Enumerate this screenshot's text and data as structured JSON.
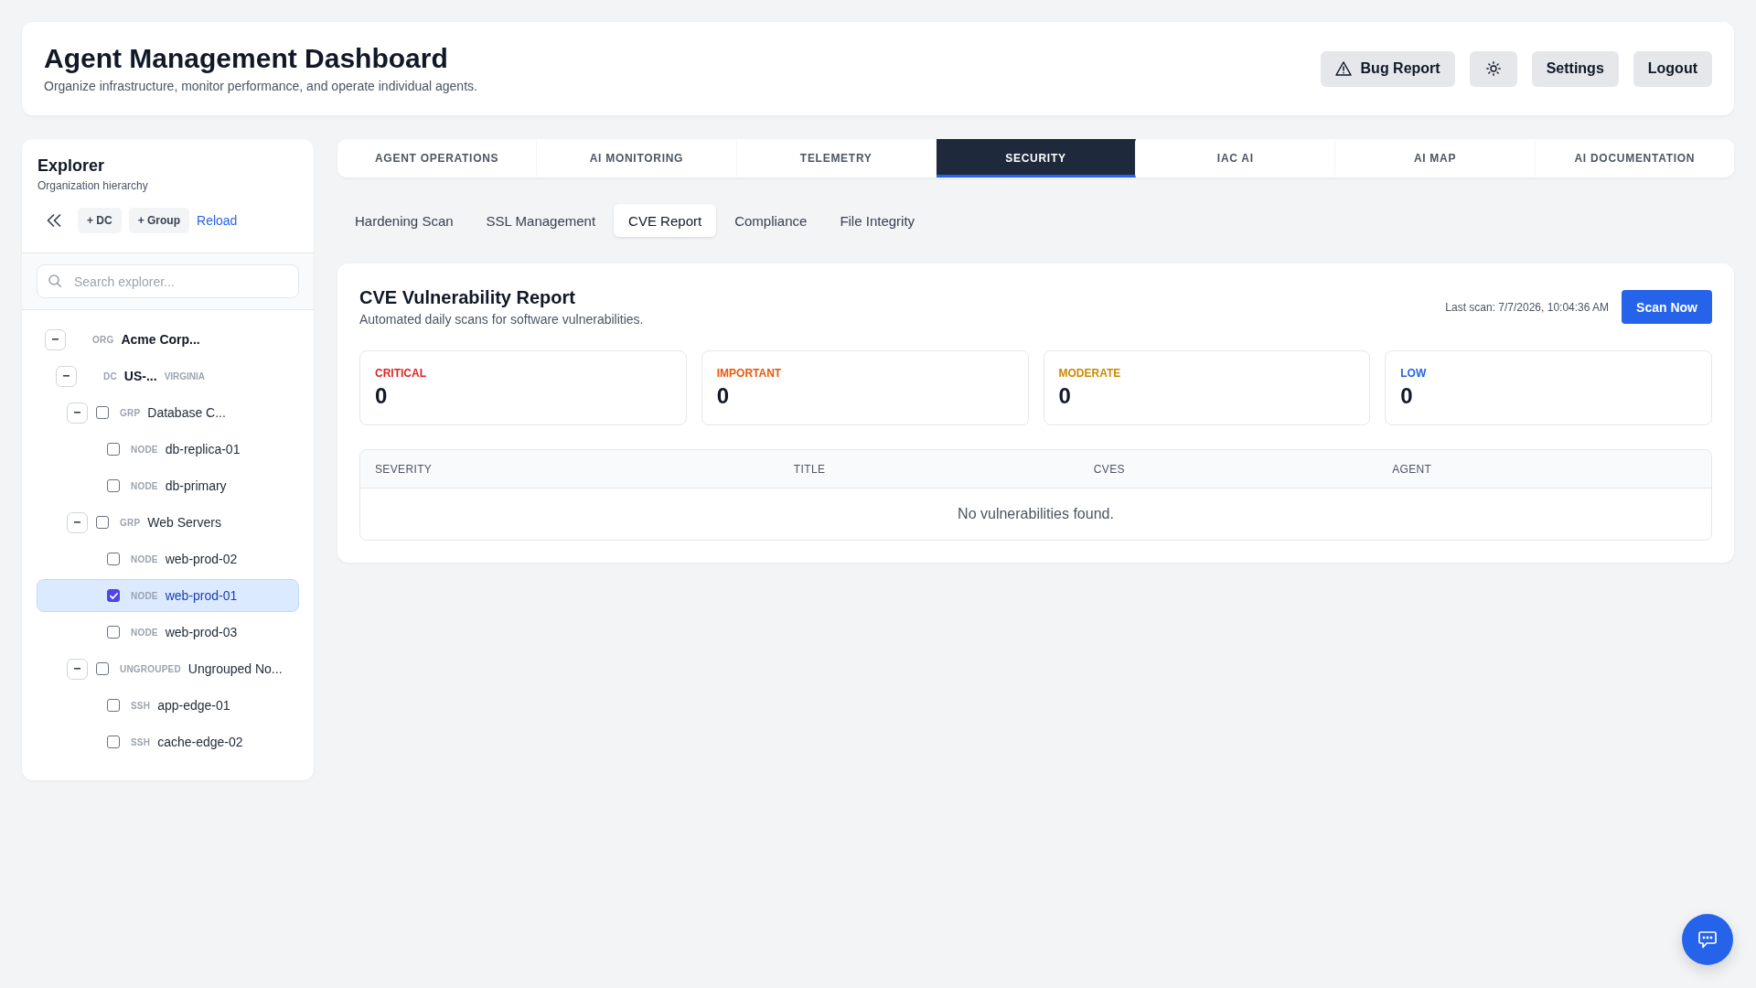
{
  "header": {
    "title": "Agent Management Dashboard",
    "subtitle": "Organize infrastructure, monitor performance, and operate individual agents.",
    "bug_report_button": "Bug Report",
    "settings_button": "Settings",
    "logout_button": "Logout"
  },
  "explorer": {
    "title": "Explorer",
    "subtitle": "Organization hierarchy",
    "add_buttons": [
      "+ DC",
      "+ Group"
    ],
    "reload_link": "Reload",
    "search": {
      "placeholder": "Search explorer..."
    },
    "tree": [
      {
        "kind": "org",
        "type_label": "ORG",
        "name": "Acme Corp...",
        "selected": false,
        "expanded": true,
        "children": [
          {
            "kind": "dc",
            "type_label": "DC",
            "name": "US-...",
            "region": "VIRGINIA",
            "selected": false,
            "expanded": true,
            "children": [
              {
                "kind": "group",
                "type_label": "GRP",
                "name": "Database C...",
                "selected": false,
                "checked": false,
                "expanded": true,
                "children": [
                  {
                    "kind": "node",
                    "type_label": "NODE",
                    "name": "db-replica-01",
                    "selected": false,
                    "checked": false
                  },
                  {
                    "kind": "node",
                    "type_label": "NODE",
                    "name": "db-primary",
                    "selected": false,
                    "checked": false
                  }
                ]
              },
              {
                "kind": "group",
                "type_label": "GRP",
                "name": "Web Servers",
                "selected": false,
                "checked": false,
                "expanded": true,
                "children": [
                  {
                    "kind": "node",
                    "type_label": "NODE",
                    "name": "web-prod-02",
                    "selected": false,
                    "checked": false
                  },
                  {
                    "kind": "node",
                    "type_label": "NODE",
                    "name": "web-prod-01",
                    "selected": true,
                    "checked": true
                  },
                  {
                    "kind": "node",
                    "type_label": "NODE",
                    "name": "web-prod-03",
                    "selected": false,
                    "checked": false
                  }
                ]
              },
              {
                "kind": "group",
                "type_label": "UNGROUPED",
                "name": "Ungrouped No...",
                "selected": false,
                "checked": false,
                "expanded": true,
                "children": [
                  {
                    "kind": "node",
                    "type_label": "SSH",
                    "name": "app-edge-01",
                    "selected": false,
                    "checked": false
                  },
                  {
                    "kind": "node",
                    "type_label": "SSH",
                    "name": "cache-edge-02",
                    "selected": false,
                    "checked": false
                  }
                ]
              }
            ]
          }
        ]
      }
    ]
  },
  "tabs": [
    {
      "label": "AGENT OPERATIONS",
      "selected": false
    },
    {
      "label": "AI MONITORING",
      "selected": false
    },
    {
      "label": "TELEMETRY",
      "selected": false
    },
    {
      "label": "SECURITY",
      "selected": true
    },
    {
      "label": "IAC AI",
      "selected": false
    },
    {
      "label": "AI MAP",
      "selected": false
    },
    {
      "label": "AI DOCUMENTATION",
      "selected": false
    }
  ],
  "subtabs": [
    {
      "label": "Hardening Scan",
      "selected": false
    },
    {
      "label": "SSL Management",
      "selected": false
    },
    {
      "label": "CVE Report",
      "selected": true
    },
    {
      "label": "Compliance",
      "selected": false
    },
    {
      "label": "File Integrity",
      "selected": false
    }
  ],
  "report": {
    "title": "CVE Vulnerability Report",
    "subtitle": "Automated daily scans for software vulnerabilities.",
    "last_scan": "Last scan: 7/7/2026, 10:04:36 AM",
    "scan_button": "Scan Now",
    "stats": [
      {
        "label": "CRITICAL",
        "value": "0",
        "color": "#dc2626"
      },
      {
        "label": "IMPORTANT",
        "value": "0",
        "color": "#ea580c"
      },
      {
        "label": "MODERATE",
        "value": "0",
        "color": "#ca8a04"
      },
      {
        "label": "LOW",
        "value": "0",
        "color": "#2563eb"
      }
    ],
    "table": {
      "columns": [
        "SEVERITY",
        "TITLE",
        "CVES",
        "AGENT"
      ],
      "empty_message": "No vulnerabilities found."
    }
  }
}
